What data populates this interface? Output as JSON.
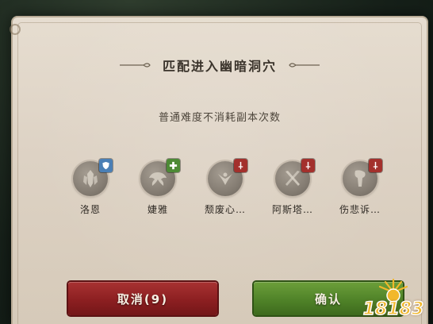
{
  "dialog": {
    "title": "匹配进入幽暗洞穴",
    "subtitle": "普通难度不消耗副本次数"
  },
  "party": [
    {
      "name": "洛恩",
      "role": "tank",
      "role_icon": "shield-icon",
      "role_color": "#4a7fb5"
    },
    {
      "name": "婕雅",
      "role": "healer",
      "role_icon": "plus-icon",
      "role_color": "#4d8a35"
    },
    {
      "name": "颓废心…",
      "role": "dps",
      "role_icon": "sword-icon",
      "role_color": "#a3302c"
    },
    {
      "name": "阿斯塔…",
      "role": "dps",
      "role_icon": "sword-icon",
      "role_color": "#a3302c"
    },
    {
      "name": "伤悲诉…",
      "role": "dps",
      "role_icon": "sword-icon",
      "role_color": "#a3302c"
    }
  ],
  "buttons": {
    "cancel_label": "取消(9)",
    "confirm_label": "确认"
  },
  "watermark": {
    "text": "18183"
  },
  "colors": {
    "cancel": "#8c1f21",
    "confirm": "#4f8228",
    "panel": "#ddd2c4"
  }
}
